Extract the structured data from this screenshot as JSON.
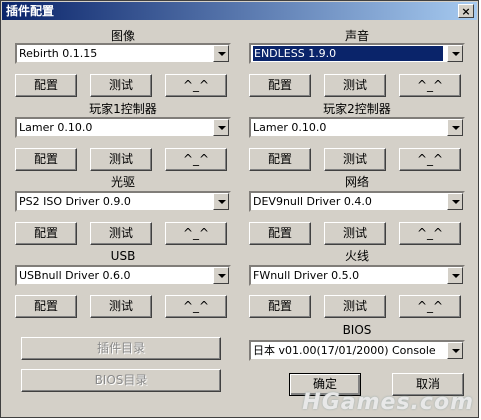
{
  "window": {
    "title": "插件配置",
    "close_label": "×"
  },
  "common": {
    "configure": "配置",
    "test": "测试",
    "about": "^_^"
  },
  "sections": {
    "graphics": {
      "label": "图像",
      "value": "Rebirth  0.1.15"
    },
    "sound": {
      "label": "声音",
      "value": "ENDLESS 1.9.0"
    },
    "pad1": {
      "label": "玩家1控制器",
      "value": "Lamer 0.10.0"
    },
    "pad2": {
      "label": "玩家2控制器",
      "value": "Lamer 0.10.0"
    },
    "cdvd": {
      "label": "光驱",
      "value": "PS2 ISO Driver 0.9.0"
    },
    "dev9": {
      "label": "网络",
      "value": "DEV9null Driver 0.4.0"
    },
    "usb": {
      "label": "USB",
      "value": "USBnull Driver 0.6.0"
    },
    "firewire": {
      "label": "火线",
      "value": "FWnull Driver 0.5.0"
    },
    "bios": {
      "label": "BIOS",
      "value": "日本  v01.00(17/01/2000) Console"
    }
  },
  "buttons": {
    "plugin_dir": "插件目录",
    "bios_dir": "BIOS目录",
    "ok": "确定",
    "cancel": "取消"
  },
  "watermark": "HGames.com"
}
